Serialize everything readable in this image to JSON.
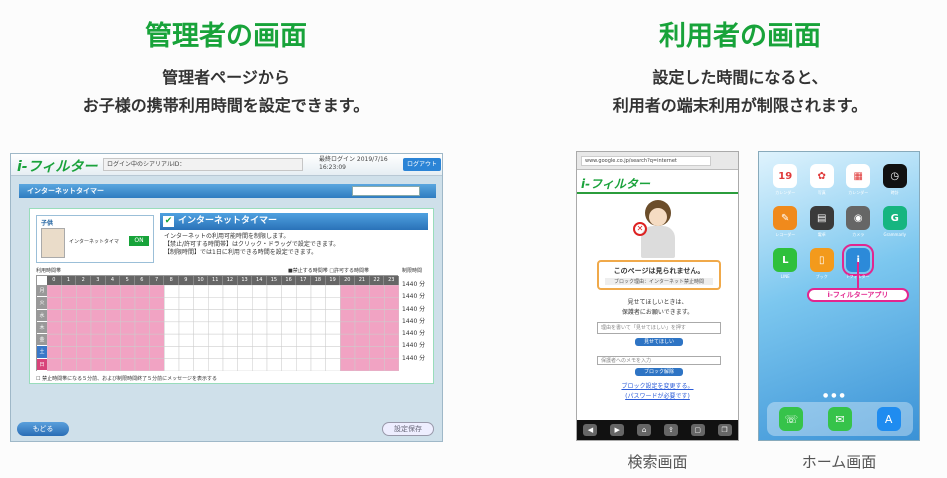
{
  "admin": {
    "heading": "管理者の画面",
    "description_lines": [
      "管理者ページから",
      "お子様の携帯利用時間を設定できます。"
    ],
    "screen": {
      "logo": "i-フィルター",
      "serial_label": "ログイン中のシアリアルID：",
      "last_login": "最終ログイン 2019/7/16 16:23:09",
      "logout": "ログアウト",
      "page_title": "インターネットタイマー",
      "child_title": "子供",
      "child_feature": "インターネットタイマ",
      "toggle": "ON",
      "section_title": "インターネットタイマー",
      "section_desc": [
        "インターネットの利用可能時間を制限します。",
        "【禁止/許可する時間帯】はクリック・ドラッグで設定できます。",
        "【制限時間】では1日に利用できる時間を設定できます。"
      ],
      "grid_title": "利用時間帯",
      "legend_forbid": "■禁止する時間帯",
      "legend_allow": "□許可する時間帯",
      "limit_header": "制限時間",
      "hours": [
        "0",
        "1",
        "2",
        "3",
        "4",
        "5",
        "6",
        "7",
        "8",
        "9",
        "10",
        "11",
        "12",
        "13",
        "14",
        "15",
        "16",
        "17",
        "18",
        "19",
        "20",
        "21",
        "22",
        "23"
      ],
      "days": [
        "月",
        "火",
        "水",
        "木",
        "金",
        "土",
        "日"
      ],
      "day_colors": [
        "#999999",
        "#999999",
        "#999999",
        "#999999",
        "#999999",
        "#3a78c8",
        "#d8437a"
      ],
      "forbidden_hours": [
        0,
        1,
        2,
        3,
        4,
        5,
        6,
        7,
        20,
        21,
        22,
        23
      ],
      "limits": [
        "1440 分",
        "1440 分",
        "1440 分",
        "1440 分",
        "1440 分",
        "1440 分",
        "1440 分"
      ],
      "message_option": "禁止時間帯になる５分前、および制限時間終了５分前にメッセージを表示する",
      "back": "もどる",
      "save": "設定保存"
    }
  },
  "user": {
    "heading": "利用者の画面",
    "description_lines": [
      "設定した時間になると、",
      "利用者の端末利用が制限されます。"
    ],
    "search_screen": {
      "caption": "検索画面",
      "url": "www.google.co.jp/search?q=internet",
      "logo": "i-フィルター",
      "blocked_title": "このページは見られません。",
      "blocked_reason": "ブロック理由：インターネット禁止時間",
      "request_lines": [
        "見せてほしいときは、",
        "保護者にお願いできます。"
      ],
      "request_placeholder": "理由を書いて「見せてほしい」を押す",
      "request_button": "見せてほしい",
      "memo_placeholder": "保護者へのメモを入力",
      "memo_button": "ブロック解除",
      "settings_link_lines": [
        "ブロック設定を変更する。",
        "(パスワードが必要です)"
      ],
      "toolbar": [
        "◀",
        "▶",
        "⌂",
        "⇪",
        "▢",
        "❐"
      ]
    },
    "home_screen": {
      "caption": "ホーム画面",
      "apps": [
        {
          "label": "カレンダー",
          "glyph": "19",
          "color": "#ffffff"
        },
        {
          "label": "写真",
          "glyph": "✿",
          "color": "#ffffff"
        },
        {
          "label": "カレンダー",
          "glyph": "▦",
          "color": "#ffffff"
        },
        {
          "label": "時計",
          "glyph": "◷",
          "color": "#111111"
        },
        {
          "label": "レコーダー",
          "glyph": "✎",
          "color": "#f08a1c"
        },
        {
          "label": "電卓",
          "glyph": "▤",
          "color": "#3a3a3a"
        },
        {
          "label": "カメラ",
          "glyph": "◉",
          "color": "#666666"
        },
        {
          "label": "Grammarly",
          "glyph": "G",
          "color": "#16b580"
        },
        {
          "label": "LINE",
          "glyph": "L",
          "color": "#2fc03c"
        },
        {
          "label": "ブック",
          "glyph": "▯",
          "color": "#f39a1c"
        },
        {
          "label": "i-フィルター",
          "glyph": "i",
          "color": "#2c8ad9"
        }
      ],
      "app_tag": "i-フィルターアプリ",
      "dock": [
        {
          "glyph": "☏",
          "color": "#36c34a"
        },
        {
          "glyph": "✉",
          "color": "#36c34a"
        },
        {
          "glyph": "A",
          "color": "#1f8cf0"
        }
      ]
    }
  }
}
